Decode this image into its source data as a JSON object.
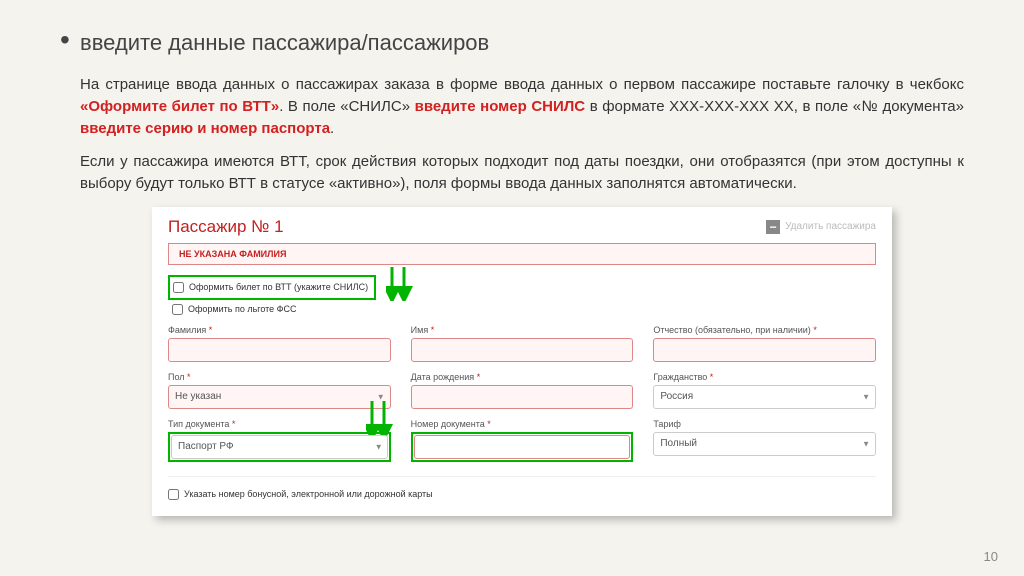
{
  "title": "введите данные пассажира/пассажиров",
  "para1": {
    "t1": "На странице ввода данных о пассажирах заказа в форме ввода данных о первом пассажире поставьте галочку в чекбокс ",
    "b1": "«Оформите билет по ВТТ»",
    "t2": ". В поле «СНИЛС» ",
    "b2": "введите номер СНИЛС",
    "t3": " в формате ХХХ-ХХХ-ХХХ ХХ, в поле «№ документа» ",
    "b3": "введите серию и номер паспорта",
    "t4": "."
  },
  "para2": "Если у пассажира имеются ВТТ, срок действия которых подходит под даты поездки, они отобразятся (при этом доступны к выбору будут только ВТТ в статусе «активно»), поля формы ввода данных заполнятся автоматически.",
  "form": {
    "pass_title": "Пассажир № 1",
    "remove_label": "Удалить пассажира",
    "error_banner": "НЕ УКАЗАНА ФАМИЛИЯ",
    "chk_vtt": "Оформить билет по ВТТ (укажите СНИЛС)",
    "chk_fss": "Оформить по льготе ФСС",
    "surname_lbl": "Фамилия",
    "name_lbl": "Имя",
    "patronymic_lbl": "Отчество (обязательно, при наличии)",
    "gender_lbl": "Пол",
    "gender_val": "Не указан",
    "dob_lbl": "Дата рождения",
    "citizen_lbl": "Гражданство",
    "citizen_val": "Россия",
    "doctype_lbl": "Тип документа",
    "doctype_val": "Паспорт РФ",
    "docnum_lbl": "Номер документа",
    "tariff_lbl": "Тариф",
    "tariff_val": "Полный",
    "bonus_lbl": "Указать номер бонусной, электронной или дорожной карты"
  },
  "pagenum": "10"
}
